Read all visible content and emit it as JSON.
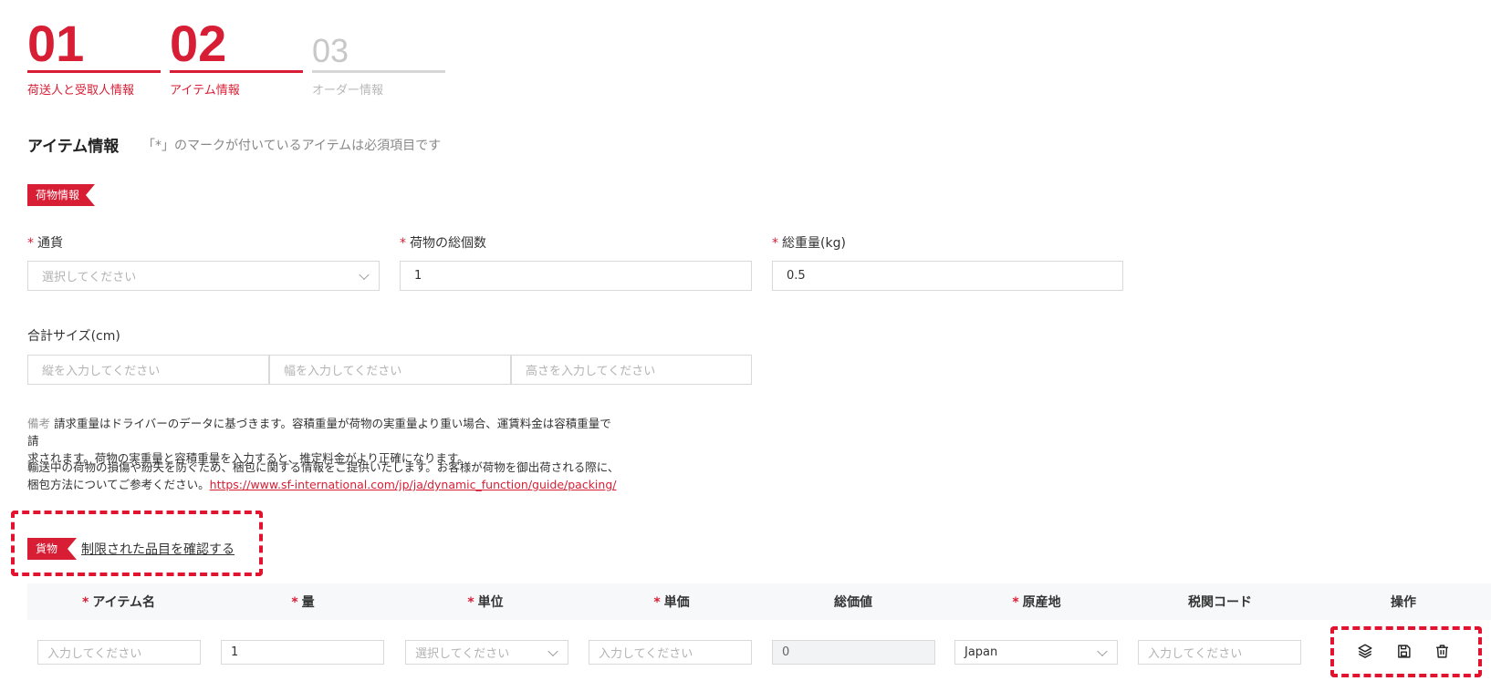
{
  "steps": [
    {
      "num": "01",
      "label": "荷送人と受取人情報",
      "state": "active"
    },
    {
      "num": "02",
      "label": "アイテム情報",
      "state": "active"
    },
    {
      "num": "03",
      "label": "オーダー情報",
      "state": "inactive"
    }
  ],
  "section": {
    "title": "アイテム情報",
    "note": "「*」のマークが付いているアイテムは必須項目です"
  },
  "package": {
    "tag": "荷物情報",
    "currency": {
      "label": "通貨",
      "placeholder": "選択してください"
    },
    "total_count": {
      "label": "荷物の総個数",
      "value": "1"
    },
    "total_weight": {
      "label": "総重量(kg)",
      "value": "0.5"
    },
    "size": {
      "label": "合計サイズ(cm)",
      "length_placeholder": "縦を入力してください",
      "width_placeholder": "幅を入力してください",
      "height_placeholder": "高さを入力してください"
    }
  },
  "notes": {
    "remark_prefix": "備考",
    "remark_line1": " 請求重量はドライバーのデータに基づきます。容積重量が荷物の実重量より重い場合、運賃料金は容積重量で請",
    "remark_line2": "求されます。荷物の実重量と容積重量を入力すると、推定料金がより正確になります。",
    "packing_line1": "輸送中の荷物の損傷や紛失を防ぐため、梱包に関する情報をご提供いたします。お客様が荷物を御出荷される際に、",
    "packing_line2": "梱包方法についてご参考ください。",
    "packing_link": "https://www.sf-international.com/jp/ja/dynamic_function/guide/packing/"
  },
  "cargo": {
    "tag": "貨物",
    "restricted_link": "制限された品目を確認する"
  },
  "table": {
    "headers": [
      {
        "label": "アイテム名",
        "required": true
      },
      {
        "label": "量",
        "required": true
      },
      {
        "label": "単位",
        "required": true
      },
      {
        "label": "単価",
        "required": true
      },
      {
        "label": "総価値",
        "required": false
      },
      {
        "label": "原産地",
        "required": true
      },
      {
        "label": "税関コード",
        "required": false
      },
      {
        "label": "操作",
        "required": false
      }
    ],
    "required_mark": "*",
    "row": {
      "item_name_placeholder": "入力してください",
      "quantity": "1",
      "unit_placeholder": "選択してください",
      "unit_price_placeholder": "入力してください",
      "total_value": "0",
      "origin": "Japan",
      "hs_code_placeholder": "入力してください"
    },
    "actions": [
      "layers-icon",
      "save-icon",
      "trash-icon"
    ]
  },
  "colors": {
    "accent": "#d71e35",
    "highlight": "#e1132e"
  }
}
